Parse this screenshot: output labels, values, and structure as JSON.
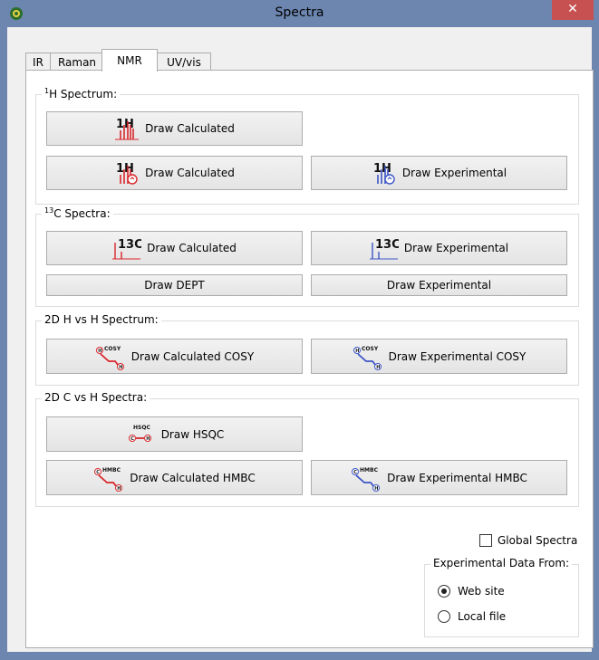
{
  "window": {
    "title": "Spectra",
    "close_glyph": "✕"
  },
  "tabs": [
    {
      "label": "IR",
      "active": false
    },
    {
      "label": "Raman",
      "active": false
    },
    {
      "label": "NMR",
      "active": true
    },
    {
      "label": "UV/vis",
      "active": false
    }
  ],
  "h_spectrum": {
    "label_sup": "1",
    "label": "H Spectrum:",
    "buttons": {
      "calc_top": {
        "label": "Draw Calculated",
        "icon": "1h-red-spectrum-icon"
      },
      "calc_second": {
        "label": "Draw Calculated",
        "icon": "1h-red-spectrum-coupling-icon"
      },
      "experimental": {
        "label": "Draw Experimental",
        "icon": "1h-blue-spectrum-icon"
      }
    }
  },
  "c_spectra": {
    "label_sup": "13",
    "label": "C Spectra:",
    "buttons": {
      "calc": {
        "label": "Draw Calculated"
      },
      "experimental": {
        "label": "Draw Experimental"
      },
      "dept": {
        "label": "Draw DEPT"
      },
      "experimental2": {
        "label": "Draw Experimental"
      }
    }
  },
  "hh_2d": {
    "label": "2D H vs H Spectrum:",
    "buttons": {
      "calc": {
        "label": "Draw Calculated COSY"
      },
      "experimental": {
        "label": "Draw Experimental COSY"
      }
    }
  },
  "ch_2d": {
    "label": "2D C vs H Spectra:",
    "buttons": {
      "hsqc": {
        "label": "Draw HSQC"
      },
      "calc_hmbc": {
        "label": "Draw Calculated HMBC"
      },
      "exp_hmbc": {
        "label": "Draw Experimental HMBC"
      }
    }
  },
  "icon_text": {
    "h": "1H",
    "c": "13C",
    "cosy": "COSY",
    "hsqc": "HSQC",
    "hmbc": "HMBC",
    "h_atom": "H",
    "c_atom": "C"
  },
  "global_spectra": {
    "label": "Global Spectra",
    "checked": false
  },
  "experimental_source": {
    "label": "Experimental Data From:",
    "options": [
      {
        "label": "Web site",
        "selected": true
      },
      {
        "label": "Local file",
        "selected": false
      }
    ]
  },
  "colors": {
    "calc": "#d9262b",
    "experimental": "#3c55c7",
    "titlebar": "#6d86b0",
    "close": "#c75050"
  }
}
